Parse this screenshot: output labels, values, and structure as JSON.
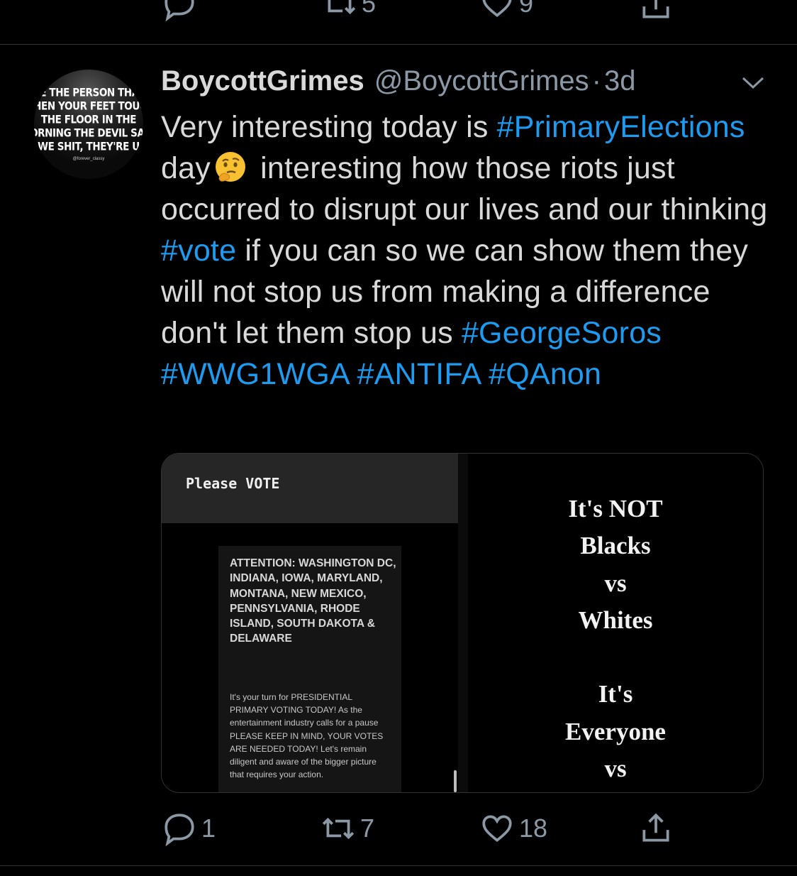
{
  "previous_tweet": {
    "retweet_count": "5",
    "like_count": "9"
  },
  "tweet": {
    "display_name": "BoycottGrimes",
    "handle": "@BoycottGrimes",
    "dot": "·",
    "time": "3d",
    "avatar_text": [
      "BE THE PERSON THAT",
      "WHEN YOUR FEET TOUCH",
      "THE FLOOR IN THE",
      "MORNING THE DEVIL SAYS",
      "\"AWE SHIT, THEY'RE UP\""
    ],
    "avatar_credit": "@forever_classy",
    "text": {
      "part1": "Very interesting today is ",
      "hashtag1": "#PrimaryElections",
      "part2": " day",
      "part3": " interesting how those riots just occurred to disrupt our lives and our thinking ",
      "hashtag2": "#vote",
      "part4": " if you can so we can show them they will not stop us from making a difference don't let them stop us ",
      "hashtag3": "#GeorgeSoros",
      "hashtag4": "#WWG1WGA",
      "hashtag5": "#ANTIFA",
      "hashtag6": "#QAnon"
    },
    "emoji": "thinking-face-icon",
    "media": {
      "left": {
        "story_title": "Please VOTE",
        "notice_heading": "ATTENTION: WASHINGTON DC, INDIANA, IOWA, MARYLAND, MONTANA, NEW MEXICO, PENNSYLVANIA, RHODE ISLAND, SOUTH DAKOTA & DELAWARE",
        "notice_body": "It's your turn for PRESIDENTIAL PRIMARY VOTING TODAY! As the entertainment industry calls for a pause PLEASE KEEP IN MIND, YOUR VOTES ARE NEEDED TODAY! Let's remain diligent and aware of the bigger picture that requires your action."
      },
      "right": {
        "lines": [
          "It's NOT",
          "Blacks",
          "vs",
          "Whites",
          "",
          "It's",
          "Everyone",
          "vs"
        ]
      }
    },
    "reply_count": "1",
    "retweet_count": "7",
    "like_count": "18"
  },
  "colors": {
    "background": "#000000",
    "text": "#d9d9d9",
    "muted": "#8b98a5",
    "hashtag": "#1d9bf0"
  }
}
